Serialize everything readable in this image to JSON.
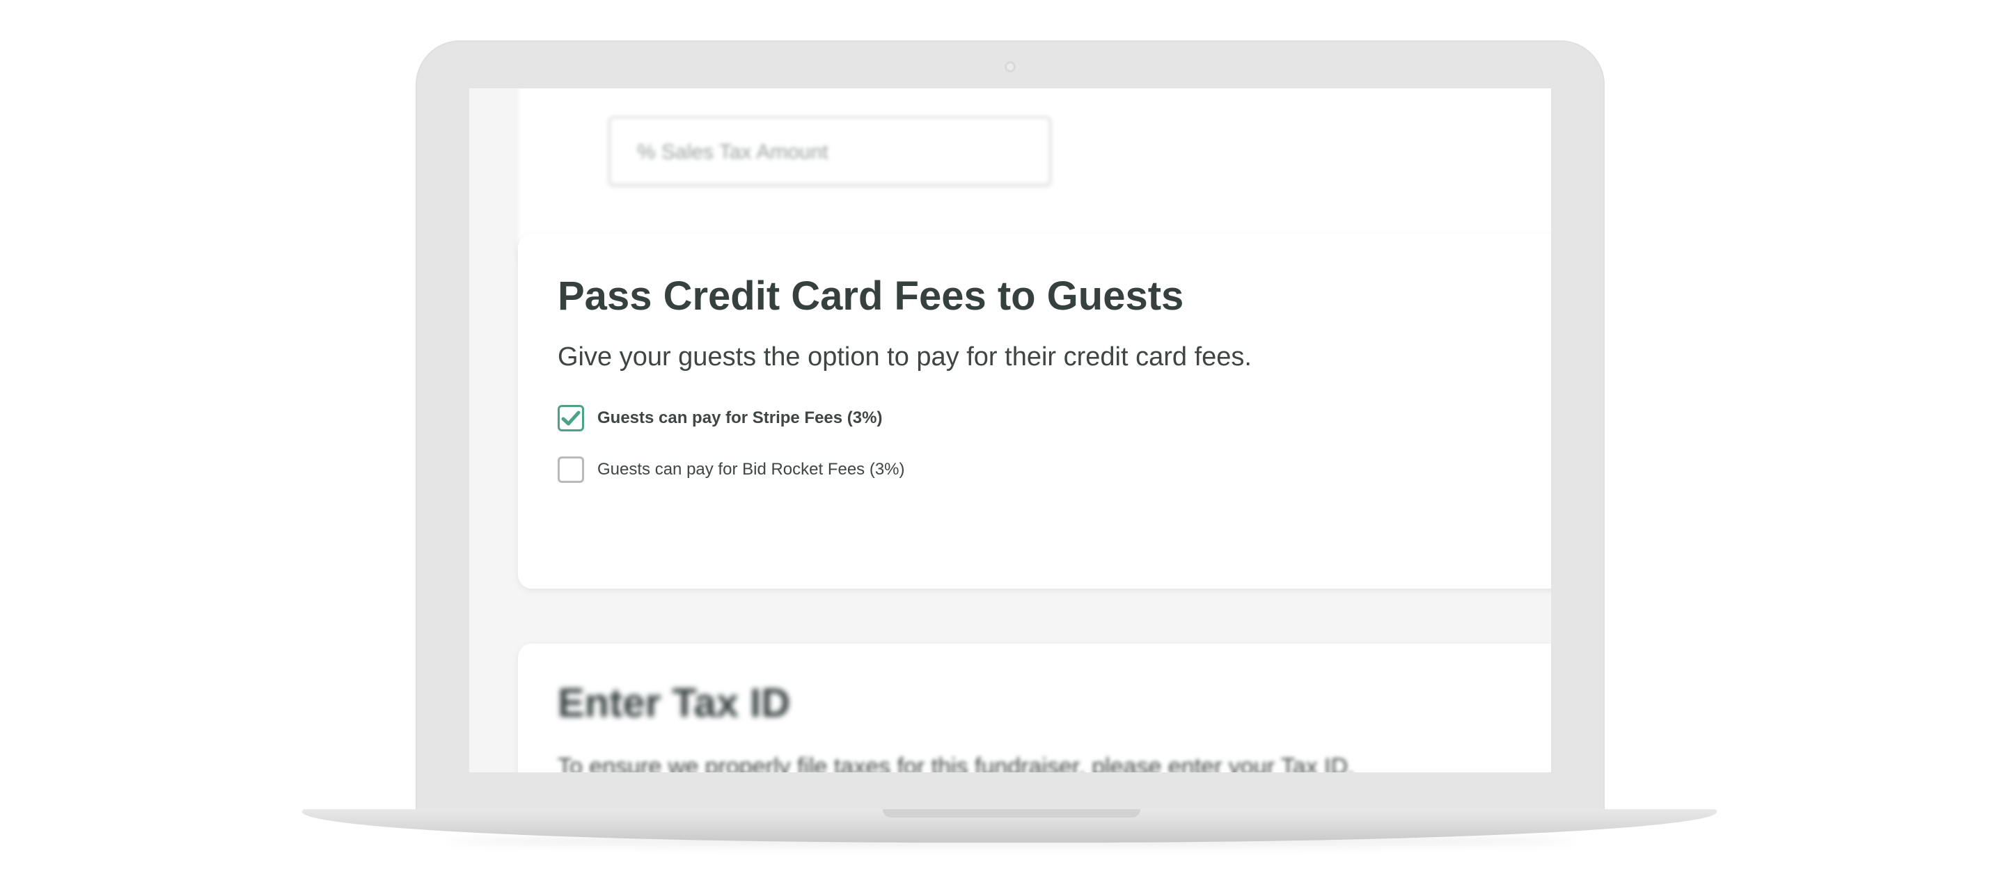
{
  "top_card": {
    "field_text": "% Sales Tax Amount"
  },
  "fees_card": {
    "title": "Pass Credit Card Fees to Guests",
    "description": "Give your guests the option to pay for their credit card fees.",
    "options": [
      {
        "label": "Guests can pay for Stripe Fees (3%)",
        "checked": true
      },
      {
        "label": "Guests can pay for Bid Rocket Fees (3%)",
        "checked": false
      }
    ]
  },
  "tax_card": {
    "title": "Enter Tax ID",
    "description": "To ensure we properly file taxes for this fundraiser, please enter your Tax ID."
  },
  "colors": {
    "accent": "#4aa388",
    "heading": "#36403f",
    "text": "#3f4544",
    "bezel": "#e5e5e5",
    "screen_bg": "#f5f5f5"
  },
  "icons": {
    "checkmark": "check-icon"
  }
}
